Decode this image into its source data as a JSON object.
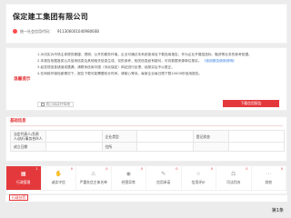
{
  "company": {
    "name": "保定建工集团有限公司",
    "credit_label": "统一社会信用代码：",
    "credit_code": "91130600104098060B"
  },
  "notice": {
    "title": "温馨提示",
    "paragraphs": [
      "1.为切实为市场主体提供便捷、透明、公开的服务环境，企业可通过本系统查询及下载信用报告，作为企业开展招投标、融资等业务的参考依据。",
      "2.本报告依据各类公共信用信息及其他相关信息生成，仅供参考，相关信息如有疑问，可向数据来源单位核实。",
      "3.如发现信息错误或遗漏，请联系信用中国（河北保定）网站进行反馈，经核实后予以更正。",
      "4.在网络环境较差情况下，报告下载可能需要较长时间，请耐心等待，每家企业每日限下载10000份信用报告。"
    ],
    "link_text": "《信用报告使用说明》",
    "agree_label": "我已阅读并知晓",
    "download_label": "下载信用报告"
  },
  "basic_info": {
    "title": "基础信息",
    "rows": [
      [
        "法定代表人/负责人/执行事务合伙人",
        "",
        "企业类型",
        "",
        "登记状态",
        ""
      ],
      [
        "成立日期",
        "",
        "住所",
        "",
        "",
        ""
      ]
    ]
  },
  "tabs": [
    {
      "label": "行政管理",
      "count": "1",
      "icon": "building-icon"
    },
    {
      "label": "诚实守信",
      "count": "0",
      "icon": "handshake-icon"
    },
    {
      "label": "严重失信主体名单",
      "count": "0",
      "icon": "warning-icon"
    },
    {
      "label": "经营异常",
      "count": "0",
      "icon": "alert-icon"
    },
    {
      "label": "信用承诺",
      "count": "0",
      "icon": "promise-icon"
    },
    {
      "label": "信用评价",
      "count": "0",
      "icon": "star-icon"
    },
    {
      "label": "司法判决",
      "count": "0",
      "icon": "gavel-icon"
    },
    {
      "label": "其他",
      "count": "0",
      "icon": "more-icon"
    }
  ],
  "subtab": {
    "label": "行政处罚"
  },
  "page_indicator": "第1条",
  "colors": {
    "accent": "#e4393c",
    "link": "#2f7be0"
  }
}
